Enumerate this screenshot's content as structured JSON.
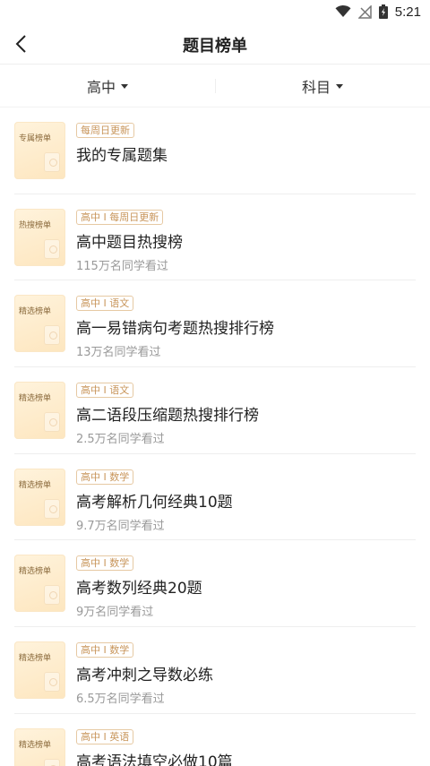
{
  "status_bar": {
    "time": "5:21",
    "icons": [
      "wifi-icon",
      "signal-off-icon",
      "battery-charging-icon"
    ]
  },
  "header": {
    "title": "题目榜单",
    "back_icon": "chevron-left-icon"
  },
  "filters": [
    {
      "label": "高中",
      "icon": "caret-down-icon"
    },
    {
      "label": "科目",
      "icon": "caret-down-icon"
    }
  ],
  "items": [
    {
      "thumb_label": "专属榜单",
      "tag": "每周日更新",
      "title": "我的专属题集",
      "views": ""
    },
    {
      "thumb_label": "热搜榜单",
      "tag": "高中 I 每周日更新",
      "title": "高中题目热搜榜",
      "views": "115万名同学看过"
    },
    {
      "thumb_label": "精选榜单",
      "tag": "高中 I 语文",
      "title": "高一易错病句考题热搜排行榜",
      "views": "13万名同学看过"
    },
    {
      "thumb_label": "精选榜单",
      "tag": "高中 I 语文",
      "title": "高二语段压缩题热搜排行榜",
      "views": "2.5万名同学看过"
    },
    {
      "thumb_label": "精选榜单",
      "tag": "高中 I 数学",
      "title": "高考解析几何经典10题",
      "views": "9.7万名同学看过"
    },
    {
      "thumb_label": "精选榜单",
      "tag": "高中 I 数学",
      "title": "高考数列经典20题",
      "views": "9万名同学看过"
    },
    {
      "thumb_label": "精选榜单",
      "tag": "高中 I 数学",
      "title": "高考冲刺之导数必练",
      "views": "6.5万名同学看过"
    },
    {
      "thumb_label": "精选榜单",
      "tag": "高中 I 英语",
      "title": "高考语法填空必做10篇",
      "views": ""
    }
  ]
}
